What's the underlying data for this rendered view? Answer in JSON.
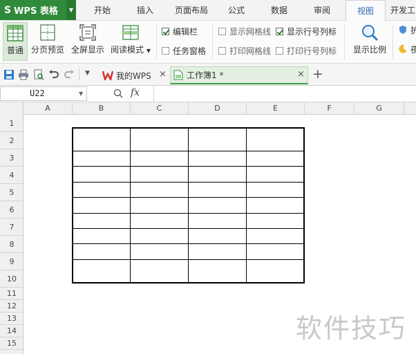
{
  "app": {
    "logo_glyph": "S",
    "title": "WPS 表格"
  },
  "menu": {
    "tabs": [
      {
        "label": "开始"
      },
      {
        "label": "插入"
      },
      {
        "label": "页面布局"
      },
      {
        "label": "公式"
      },
      {
        "label": "数据"
      },
      {
        "label": "审阅"
      },
      {
        "label": "视图"
      },
      {
        "label": "开发工"
      }
    ],
    "active_tab": "视图"
  },
  "ribbon": {
    "view_buttons": [
      {
        "label": "普通",
        "selected": true
      },
      {
        "label": "分页预览"
      },
      {
        "label": "全屏显示"
      },
      {
        "label": "阅读模式"
      }
    ],
    "checkboxes": [
      {
        "label": "编辑栏",
        "checked": true
      },
      {
        "label": "任务窗格",
        "checked": false
      },
      {
        "label": "显示网格线",
        "checked": false
      },
      {
        "label": "打印网格线",
        "checked": false
      },
      {
        "label": "显示行号列标",
        "checked": true
      },
      {
        "label": "打印行号列标",
        "checked": false
      }
    ],
    "zoom_label": "显示比例",
    "edge_label_1": "护",
    "edge_label_2": "夜"
  },
  "doc_tabs": [
    {
      "label": "我的WPS"
    },
    {
      "label": "工作簿1 *",
      "active": true
    }
  ],
  "formula_bar": {
    "name_box": "U22",
    "fx_label": "fx"
  },
  "sheet": {
    "columns": [
      "A",
      "B",
      "C",
      "D",
      "E",
      "F",
      "G"
    ],
    "rows": [
      "1",
      "2",
      "3",
      "4",
      "5",
      "6",
      "7",
      "8",
      "9",
      "10",
      "11",
      "12",
      "13",
      "14",
      "15"
    ],
    "table_range": "B2:E10"
  },
  "watermark": "软件技巧",
  "colors": {
    "brand_green": "#2f8b3a",
    "accent_blue": "#2b6ab1"
  }
}
